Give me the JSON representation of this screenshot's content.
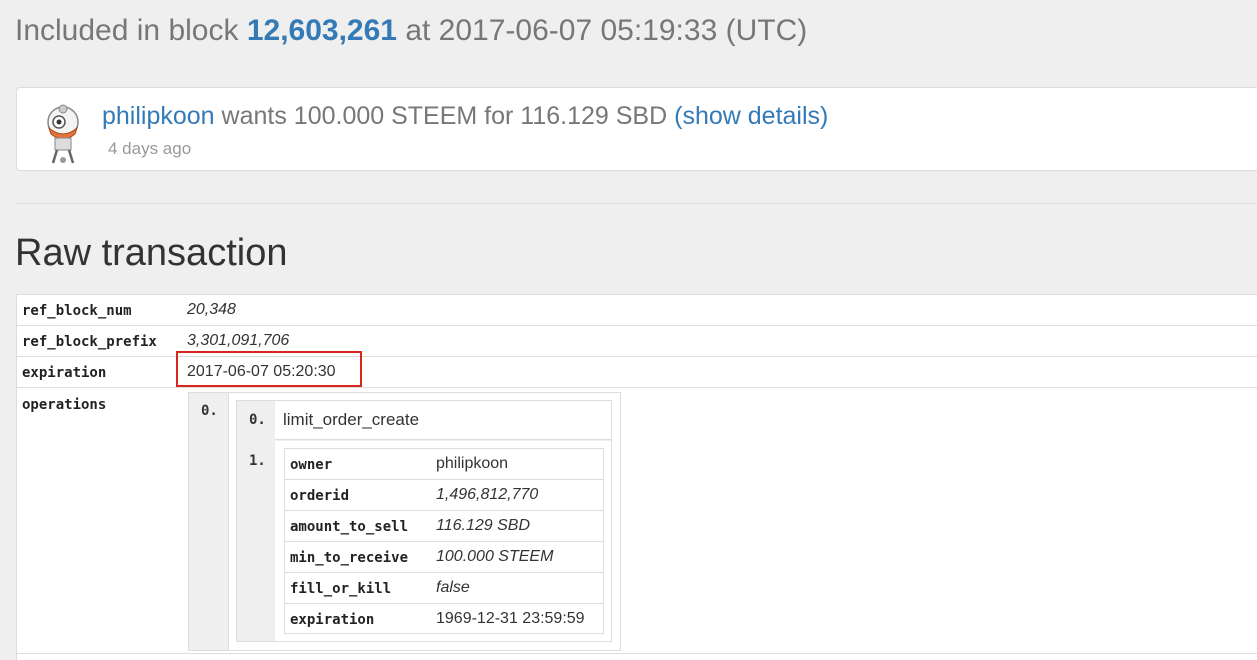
{
  "header": {
    "prefix": "Included in block",
    "block_number": "12,603,261",
    "suffix": "at 2017-06-07 05:19:33 (UTC)"
  },
  "operation": {
    "user": "philipkoon",
    "summary": "wants 100.000 STEEM for 116.129 SBD",
    "details_link": "(show details)",
    "time_ago": "4 days ago"
  },
  "raw": {
    "title": "Raw transaction",
    "rows": [
      {
        "key": "ref_block_num",
        "value": "20,348"
      },
      {
        "key": "ref_block_prefix",
        "value": "3,301,091,706"
      },
      {
        "key": "expiration",
        "value": "2017-06-07 05:20:30"
      },
      {
        "key": "operations",
        "value": ""
      }
    ],
    "operations": {
      "index": "0.",
      "name_index": "0.",
      "name": "limit_order_create",
      "params_index": "1.",
      "params": [
        {
          "key": "owner",
          "value": "philipkoon"
        },
        {
          "key": "orderid",
          "value": "1,496,812,770"
        },
        {
          "key": "amount_to_sell",
          "value": "116.129 SBD"
        },
        {
          "key": "min_to_receive",
          "value": "100.000 STEEM"
        },
        {
          "key": "fill_or_kill",
          "value": "false"
        },
        {
          "key": "expiration",
          "value": "1969-12-31 23:59:59"
        }
      ]
    }
  },
  "colors": {
    "link": "#337ab7",
    "highlight": "#d9261c",
    "background": "#efefef"
  }
}
